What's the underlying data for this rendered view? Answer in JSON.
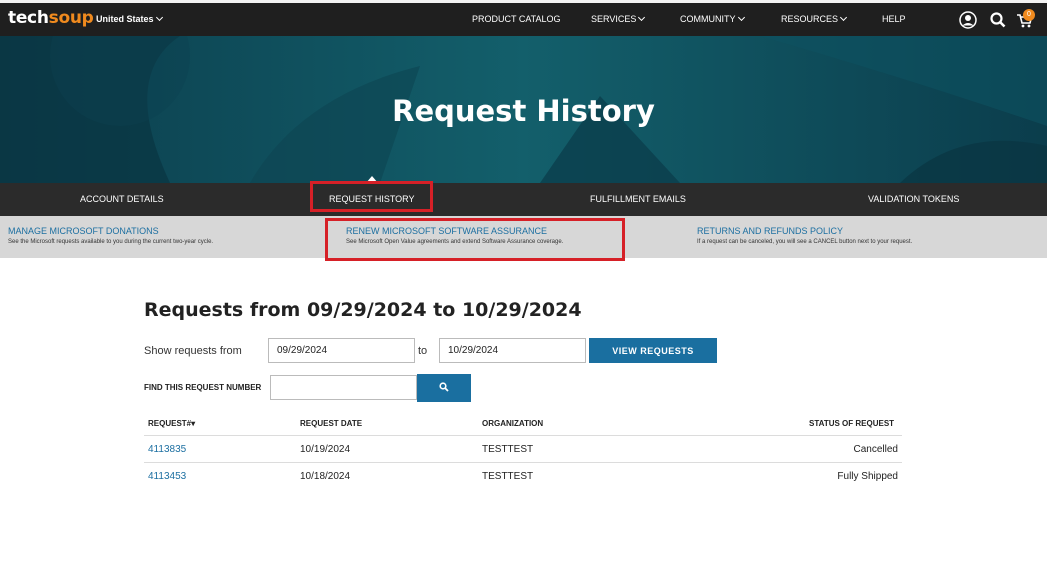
{
  "header": {
    "logo_part1": "tech",
    "logo_part2": "soup",
    "region": "United States",
    "nav": [
      "PRODUCT CATALOG",
      "SERVICES",
      "COMMUNITY",
      "RESOURCES",
      "HELP"
    ],
    "cart_count": "0"
  },
  "hero": {
    "title": "Request History"
  },
  "account_tabs": [
    "ACCOUNT DETAILS",
    "REQUEST HISTORY",
    "FULFILLMENT EMAILS",
    "VALIDATION TOKENS"
  ],
  "subnav": [
    {
      "title": "MANAGE MICROSOFT DONATIONS",
      "desc": "See the Microsoft requests available to you during the current two-year cycle."
    },
    {
      "title": "RENEW MICROSOFT SOFTWARE ASSURANCE",
      "desc": "See Microsoft Open Value agreements and extend Software Assurance coverage."
    },
    {
      "title": "RETURNS AND REFUNDS POLICY",
      "desc": "If a request can be canceled, you will see a CANCEL button next to your request."
    }
  ],
  "filter": {
    "heading": "Requests from 09/29/2024 to 10/29/2024",
    "show_label": "Show requests from",
    "from_value": "09/29/2024",
    "to_label": "to",
    "to_value": "10/29/2024",
    "view_button": "VIEW REQUESTS",
    "find_label": "FIND THIS REQUEST NUMBER",
    "find_value": ""
  },
  "table": {
    "headers": [
      "REQUEST#▾",
      "REQUEST DATE",
      "ORGANIZATION",
      "STATUS OF REQUEST"
    ],
    "rows": [
      {
        "number": "4113835",
        "date": "10/19/2024",
        "org": "TESTTEST",
        "status": "Cancelled"
      },
      {
        "number": "4113453",
        "date": "10/18/2024",
        "org": "TESTTEST",
        "status": "Fully Shipped"
      }
    ]
  },
  "colors": {
    "accent_blue": "#1a6fa0",
    "highlight_red": "#d62027",
    "brand_orange": "#f08a1e"
  }
}
